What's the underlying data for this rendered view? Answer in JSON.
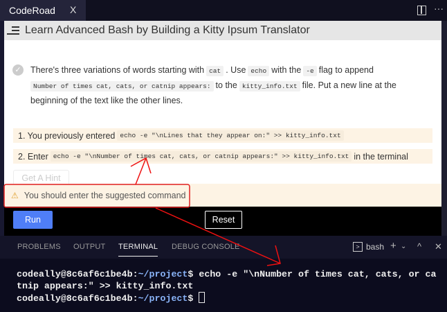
{
  "tab": {
    "title": "CodeRoad",
    "close": "X"
  },
  "header": {
    "title": "Learn Advanced Bash by Building a Kitty Ipsum Translator"
  },
  "step": {
    "t1": "There's three variations of words starting with",
    "c1": "cat",
    "t2": ". Use",
    "c2": "echo",
    "t3": "with the",
    "c3": "-e",
    "t4": "flag to append",
    "c4": "Number of times cat, cats, or catnip appears:",
    "t5": "to the",
    "c5": "kitty_info.txt",
    "t6": "file. Put a new line at the beginning of the text like the other lines."
  },
  "rows": [
    {
      "prefix": "1. You previously entered",
      "code": "echo -e \"\\nLines that they appear on:\" >> kitty_info.txt",
      "suffix": ""
    },
    {
      "prefix": "2. Enter",
      "code": "echo -e \"\\nNumber of times cat, cats, or catnip appears:\" >> kitty_info.txt",
      "suffix": "in the terminal"
    }
  ],
  "hint_label": "Get A Hint",
  "warning": "You should enter the suggested command",
  "run_label": "Run",
  "reset_label": "Reset",
  "panel": {
    "tabs": [
      "PROBLEMS",
      "OUTPUT",
      "TERMINAL",
      "DEBUG CONSOLE"
    ],
    "shell": "bash"
  },
  "terminal": {
    "user": "codeally@8c6af6c1be4b",
    "path": "~/project",
    "prompt": "$",
    "line1": " echo -e \"\\nNumber of times cat, cats, or ca",
    "line2": "tnip appears:\" >> kitty_info.txt"
  }
}
